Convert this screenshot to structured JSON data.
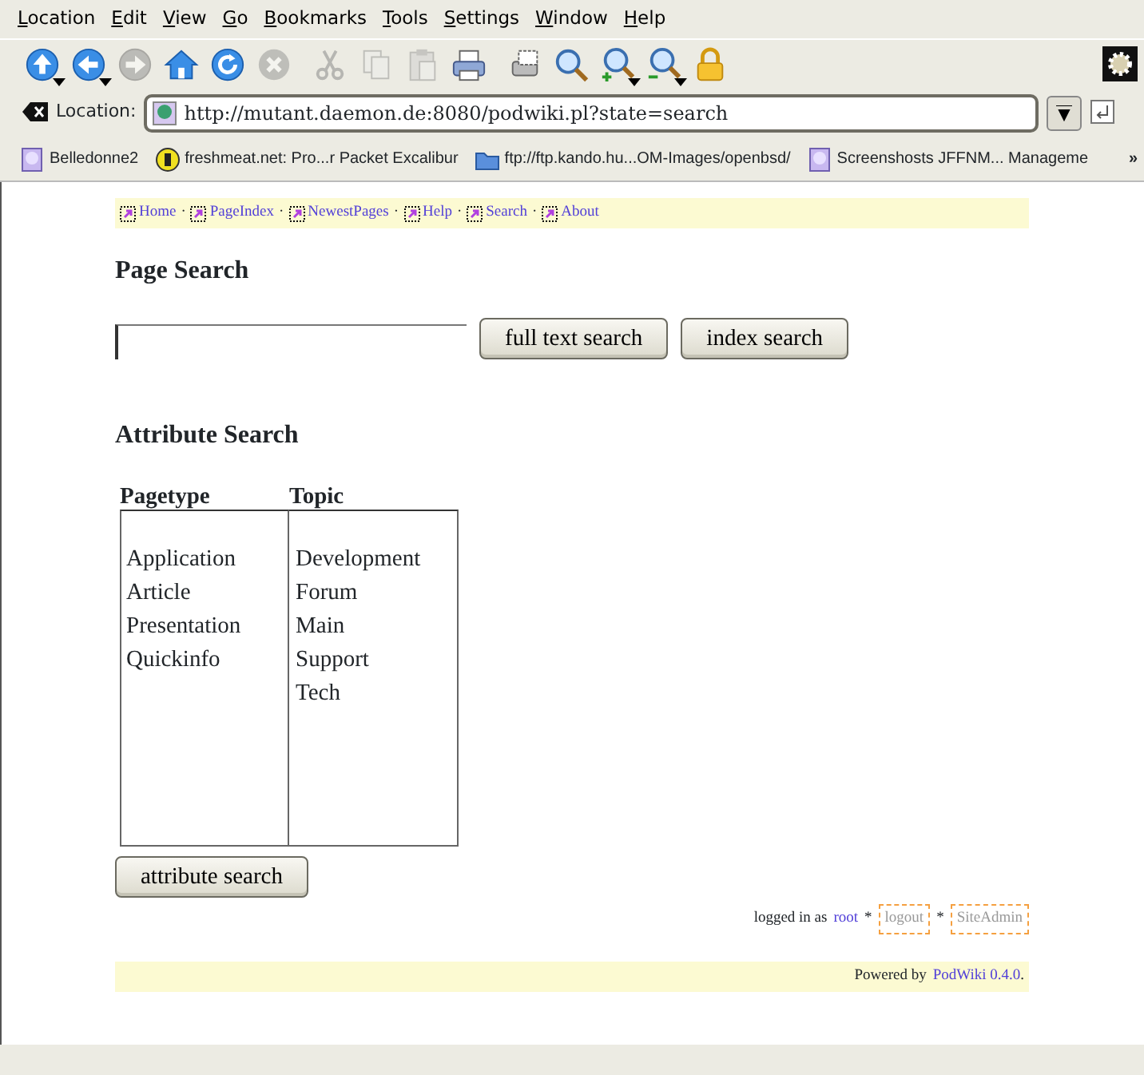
{
  "menu": [
    {
      "label": "Location"
    },
    {
      "label": "Edit"
    },
    {
      "label": "View"
    },
    {
      "label": "Go"
    },
    {
      "label": "Bookmarks"
    },
    {
      "label": "Tools"
    },
    {
      "label": "Settings"
    },
    {
      "label": "Window"
    },
    {
      "label": "Help"
    }
  ],
  "toolbar": [
    {
      "kind": "up",
      "disabled": false,
      "dropdown": true
    },
    {
      "kind": "back",
      "disabled": false,
      "dropdown": true
    },
    {
      "kind": "forward",
      "disabled": true,
      "dropdown": false
    },
    {
      "kind": "home",
      "disabled": false,
      "dropdown": false
    },
    {
      "kind": "reload",
      "disabled": false,
      "dropdown": false
    },
    {
      "kind": "stop",
      "disabled": true,
      "dropdown": false
    },
    {
      "kind": "cut",
      "disabled": true,
      "dropdown": false
    },
    {
      "kind": "copy",
      "disabled": true,
      "dropdown": false
    },
    {
      "kind": "paste",
      "disabled": true,
      "dropdown": false
    },
    {
      "kind": "print",
      "disabled": false,
      "dropdown": false
    },
    {
      "kind": "preview",
      "disabled": false,
      "dropdown": false
    },
    {
      "kind": "find",
      "disabled": false,
      "dropdown": false
    },
    {
      "kind": "zoom-in",
      "disabled": false,
      "dropdown": true
    },
    {
      "kind": "zoom-out",
      "disabled": false,
      "dropdown": true
    },
    {
      "kind": "lock",
      "disabled": false,
      "dropdown": false
    }
  ],
  "location": {
    "label": "Location:",
    "url": "http://mutant.daemon.de:8080/podwiki.pl?state=search"
  },
  "bookmarks": [
    {
      "kind": "page",
      "label": "Belledonne2"
    },
    {
      "kind": "info",
      "label": "freshmeat.net: Pro...r Packet Excalibur"
    },
    {
      "kind": "folder",
      "label": "ftp://ftp.kando.hu...OM-Images/openbsd/"
    },
    {
      "kind": "page",
      "label": "Screenshosts JFFNM... Manageme"
    }
  ],
  "bookmarks_more": "»",
  "nav_links": [
    {
      "label": "Home"
    },
    {
      "label": "PageIndex"
    },
    {
      "label": "NewestPages"
    },
    {
      "label": "Help"
    },
    {
      "label": "Search"
    },
    {
      "label": "About"
    }
  ],
  "nav_separator": "·",
  "page_search": {
    "heading": "Page Search",
    "buttons": [
      "full text search",
      "index search"
    ]
  },
  "attribute_search": {
    "heading": "Attribute Search",
    "lists": [
      {
        "header": "Pagetype",
        "options": [
          "Application",
          "Article",
          "Presentation",
          "Quickinfo"
        ]
      },
      {
        "header": "Topic",
        "options": [
          "Development",
          "Forum",
          "Main",
          "Support",
          "Tech"
        ]
      }
    ],
    "button": "attribute search"
  },
  "login": {
    "prefix": "logged in as",
    "user": "root",
    "separator": "*",
    "links": [
      "logout",
      "SiteAdmin"
    ]
  },
  "footer": {
    "prefix": "Powered by",
    "link": "PodWiki 0.4.0",
    "suffix": "."
  }
}
